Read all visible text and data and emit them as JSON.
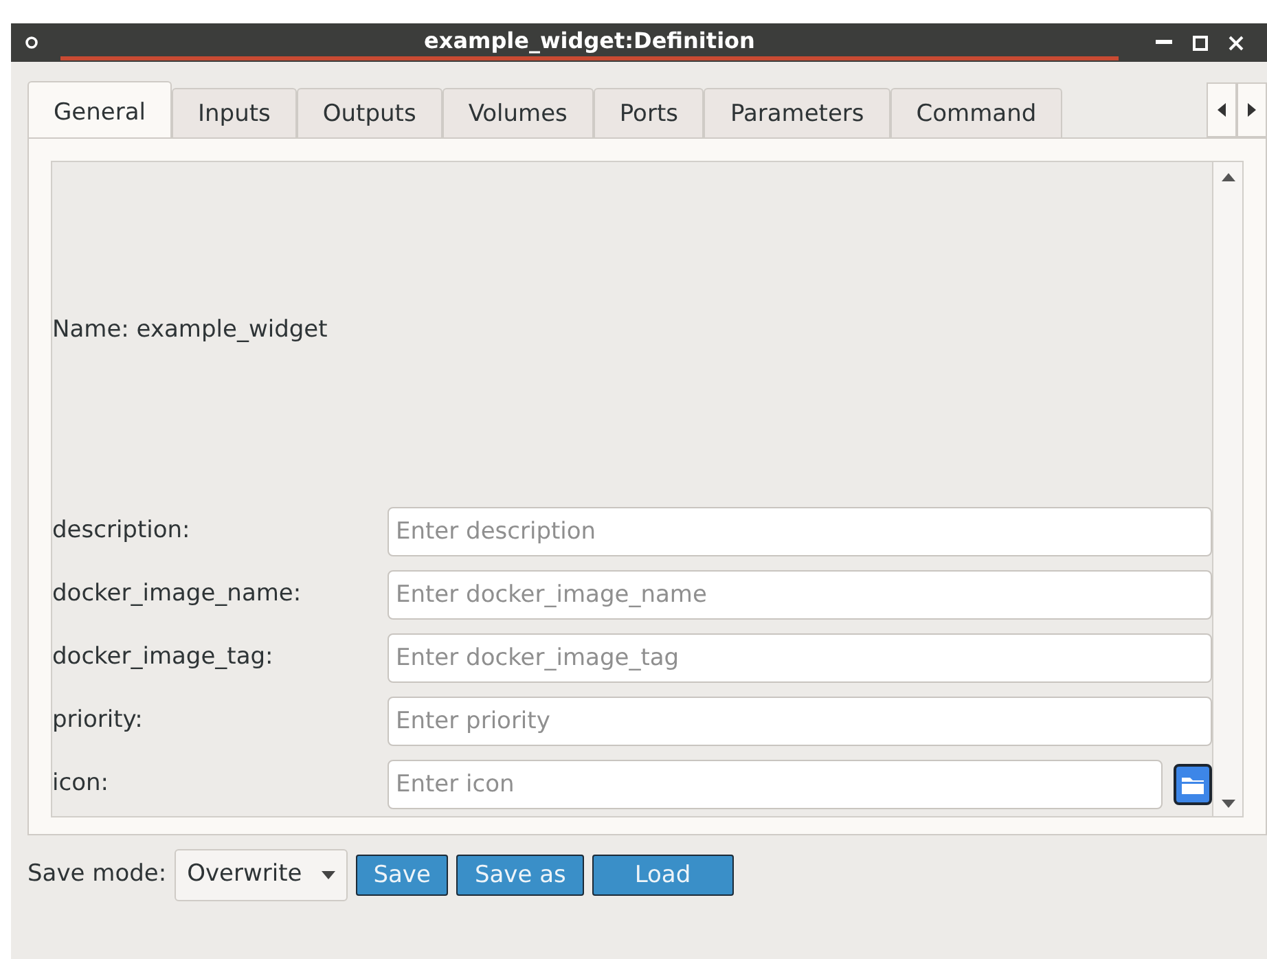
{
  "window": {
    "title": "example_widget:Definition"
  },
  "tabs": [
    {
      "label": "General",
      "selected": true
    },
    {
      "label": "Inputs",
      "selected": false
    },
    {
      "label": "Outputs",
      "selected": false
    },
    {
      "label": "Volumes",
      "selected": false
    },
    {
      "label": "Ports",
      "selected": false
    },
    {
      "label": "Parameters",
      "selected": false
    },
    {
      "label": "Command",
      "selected": false
    }
  ],
  "name_label": "Name: example_widget",
  "fields": [
    {
      "label": "description:",
      "placeholder": "Enter description",
      "kind": "text"
    },
    {
      "label": "docker_image_name:",
      "placeholder": "Enter docker_image_name",
      "kind": "text"
    },
    {
      "label": "docker_image_tag:",
      "placeholder": "Enter docker_image_tag",
      "kind": "text"
    },
    {
      "label": "priority:",
      "placeholder": "Enter priority",
      "kind": "text"
    },
    {
      "label": "icon:",
      "placeholder": "Enter icon",
      "kind": "file"
    }
  ],
  "save_mode": {
    "label": "Save mode:",
    "value": "Overwrite"
  },
  "buttons": [
    "Save",
    "Save as",
    "Load"
  ]
}
